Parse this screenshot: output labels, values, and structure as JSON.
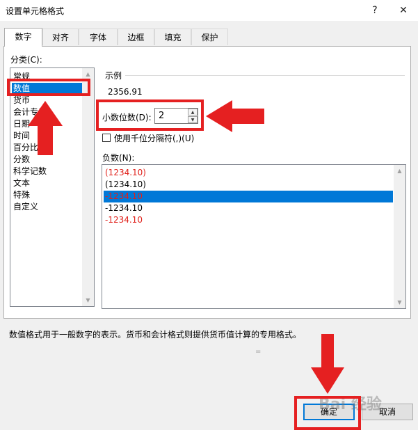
{
  "window": {
    "title": "设置单元格格式",
    "help_glyph": "?",
    "close_glyph": "✕"
  },
  "tabs": [
    {
      "label": "数字",
      "active": true
    },
    {
      "label": "对齐"
    },
    {
      "label": "字体"
    },
    {
      "label": "边框"
    },
    {
      "label": "填充"
    },
    {
      "label": "保护"
    }
  ],
  "category": {
    "label": "分类(C):",
    "items": [
      "常规",
      "数值",
      "货币",
      "会计专用",
      "日期",
      "时间",
      "百分比",
      "分数",
      "科学记数",
      "文本",
      "特殊",
      "自定义"
    ],
    "selected": "数值"
  },
  "sample": {
    "label": "示例",
    "value": "2356.91"
  },
  "decimal_places": {
    "label": "小数位数(D):",
    "value": "2"
  },
  "thousands_separator": {
    "label": "使用千位分隔符(,)(U)",
    "checked": false
  },
  "negative_numbers": {
    "label": "负数(N):",
    "items": [
      {
        "text": "(1234.10)",
        "red": true
      },
      {
        "text": "(1234.10)",
        "red": false
      },
      {
        "text": "-1234.10",
        "red": true,
        "selected": true
      },
      {
        "text": "-1234.10",
        "red": false
      },
      {
        "text": "-1234.10",
        "red": true
      }
    ]
  },
  "description": "数值格式用于一般数字的表示。货币和会计格式则提供货币值计算的专用格式。",
  "buttons": {
    "ok": "确定",
    "cancel": "取消"
  },
  "watermark": "Bai 经验",
  "colors": {
    "annotation_red": "#e52021",
    "selection_blue": "#0078d7",
    "negative_red": "#e0201a"
  }
}
